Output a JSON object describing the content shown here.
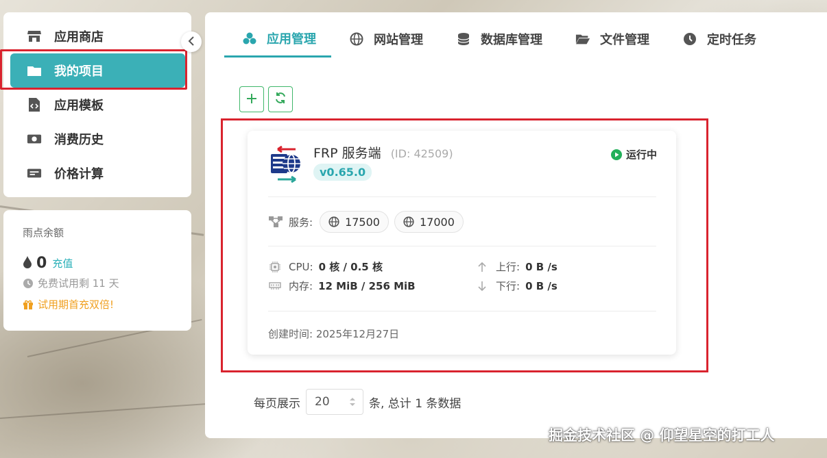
{
  "sidebar": {
    "items": [
      {
        "label": "应用商店",
        "icon": "store-icon"
      },
      {
        "label": "我的项目",
        "icon": "folder-icon",
        "active": true
      },
      {
        "label": "应用模板",
        "icon": "file-code-icon"
      },
      {
        "label": "消费历史",
        "icon": "money-icon"
      },
      {
        "label": "价格计算",
        "icon": "calculator-icon"
      }
    ]
  },
  "balance": {
    "title": "雨点余额",
    "amount": "0",
    "recharge_label": "充值",
    "trial_text": "免费试用剩 11 天",
    "promo_text": "试用期首充双倍!"
  },
  "tabs": [
    {
      "label": "应用管理",
      "icon": "cubes-icon",
      "active": true
    },
    {
      "label": "网站管理",
      "icon": "globe-icon"
    },
    {
      "label": "数据库管理",
      "icon": "database-icon"
    },
    {
      "label": "文件管理",
      "icon": "folder-open-icon"
    },
    {
      "label": "定时任务",
      "icon": "clock-icon"
    }
  ],
  "project": {
    "name": "FRP 服务端",
    "id_text": "(ID: 42509)",
    "version": "v0.65.0",
    "status": "运行中",
    "services_label": "服务:",
    "ports": [
      "17500",
      "17000"
    ],
    "cpu_label": "CPU:",
    "cpu_value": "0 核 / 0.5 核",
    "mem_label": "内存:",
    "mem_value": "12 MiB / 256 MiB",
    "up_label": "上行:",
    "up_value": "0 B /s",
    "down_label": "下行:",
    "down_value": "0 B /s",
    "created_text": "创建时间: 2025年12月27日"
  },
  "pagination": {
    "prefix": "每页展示",
    "page_size": "20",
    "suffix": "条, 总计 1 条数据"
  },
  "watermark": "掘金技术社区 @ 仰望星空的打工人",
  "colors": {
    "accent": "#3bb0b7",
    "highlight_box": "#d9232e",
    "running": "#22b05a",
    "promo": "#f0a020"
  }
}
